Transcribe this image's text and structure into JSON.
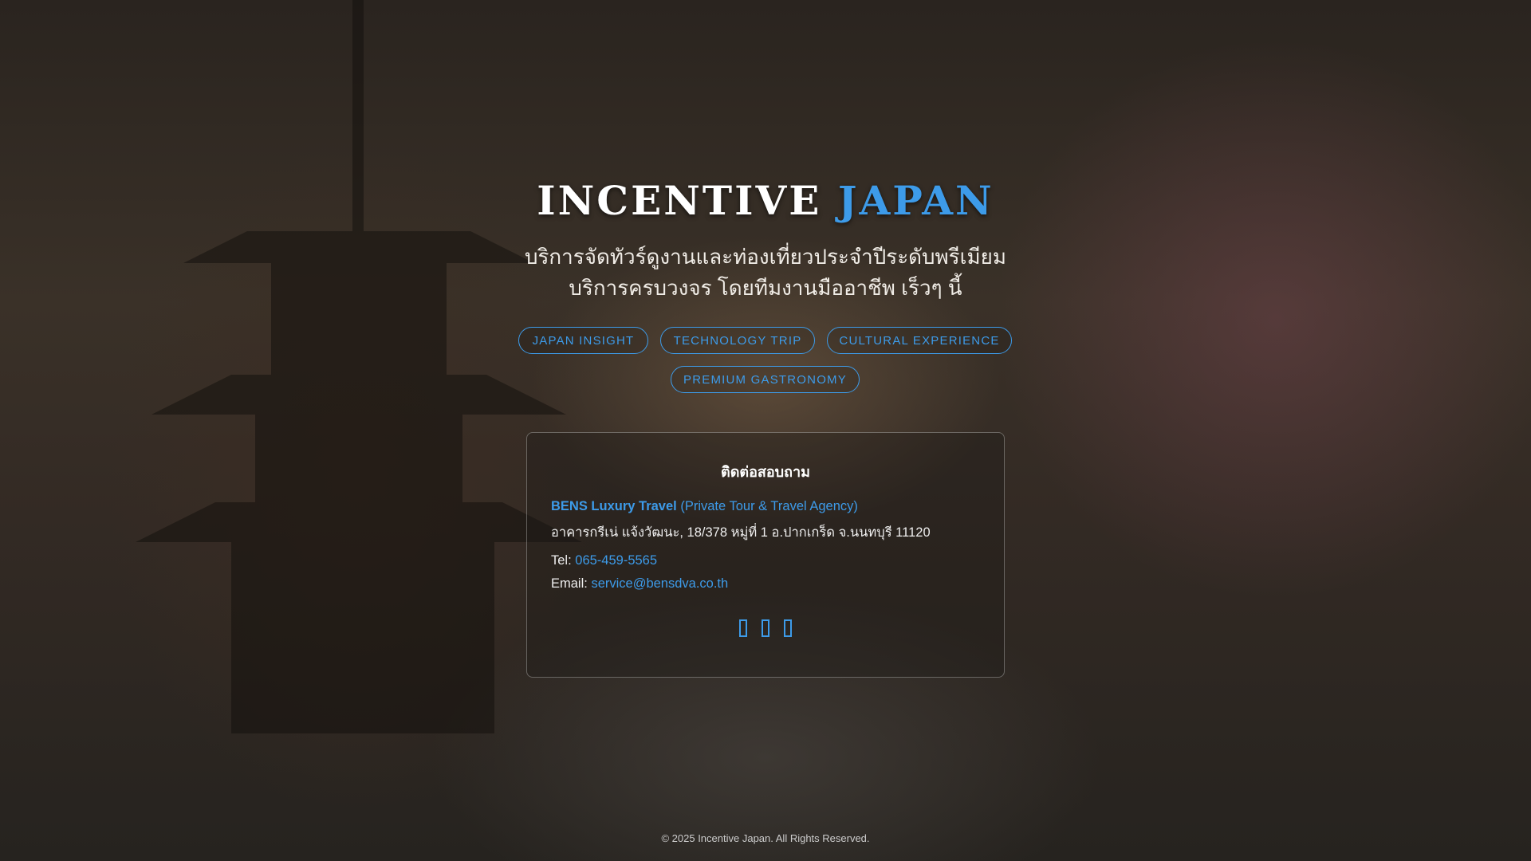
{
  "hero": {
    "title_main": "INCENTIVE",
    "title_accent": "JAPAN",
    "subtitle_line1": "บริการจัดทัวร์ดูงานและท่องเที่ยวประจำปีระดับพรีเมียม",
    "subtitle_line2": "บริการครบวงจร โดยทีมงานมืออาชีพ เร็วๆ นี้"
  },
  "tags": [
    "JAPAN INSIGHT",
    "TECHNOLOGY TRIP",
    "CULTURAL EXPERIENCE",
    "PREMIUM GASTRONOMY"
  ],
  "contact": {
    "heading": "ติดต่อสอบถาม",
    "company": "BENS Luxury Travel",
    "company_desc": "(Private Tour & Travel Agency)",
    "address": "อาคารกรีเน่ แจ้งวัฒนะ, 18/378 หมู่ที่ 1 อ.ปากเกร็ด จ.นนทบุรี 11120",
    "tel_label": "Tel:",
    "tel": "065-459-5565",
    "email_label": "Email:",
    "email": "service@bensdva.co.th",
    "social_icons": [
      "facebook-icon",
      "line-icon",
      "instagram-icon"
    ]
  },
  "footer": {
    "copyright": "© 2025 Incentive Japan. All Rights Reserved."
  },
  "colors": {
    "accent": "#3d9be9"
  }
}
